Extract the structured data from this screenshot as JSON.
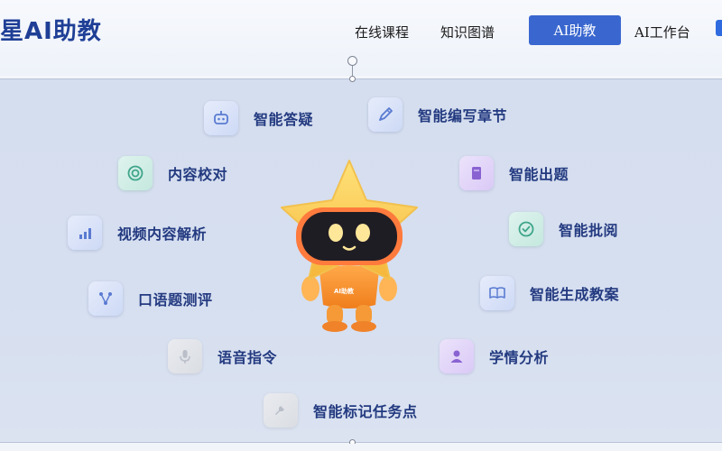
{
  "header": {
    "brand": "星AI助教",
    "nav": [
      {
        "label": "在线课程",
        "active": false
      },
      {
        "label": "知识图谱",
        "active": false
      },
      {
        "label": "AI助教",
        "active": true
      },
      {
        "label": "AI工作台",
        "active": false
      }
    ]
  },
  "mascot": {
    "badge": "AI助教"
  },
  "features": [
    {
      "label": "智能答疑",
      "icon": "robot-icon"
    },
    {
      "label": "智能编写章节",
      "icon": "pen-icon"
    },
    {
      "label": "内容校对",
      "icon": "target-icon"
    },
    {
      "label": "智能出题",
      "icon": "book-icon"
    },
    {
      "label": "视频内容解析",
      "icon": "bar-chart-icon"
    },
    {
      "label": "智能批阅",
      "icon": "check-icon"
    },
    {
      "label": "口语题测评",
      "icon": "network-icon"
    },
    {
      "label": "智能生成教案",
      "icon": "open-book-icon"
    },
    {
      "label": "语音指令",
      "icon": "microphone-icon"
    },
    {
      "label": "学情分析",
      "icon": "user-icon"
    },
    {
      "label": "智能标记任务点",
      "icon": "pin-icon"
    }
  ],
  "colors": {
    "brand": "#1f3f96",
    "nav_active_bg": "#3a67cf",
    "feature_text": "#233a80",
    "panel_bg": "#d6dff0"
  }
}
